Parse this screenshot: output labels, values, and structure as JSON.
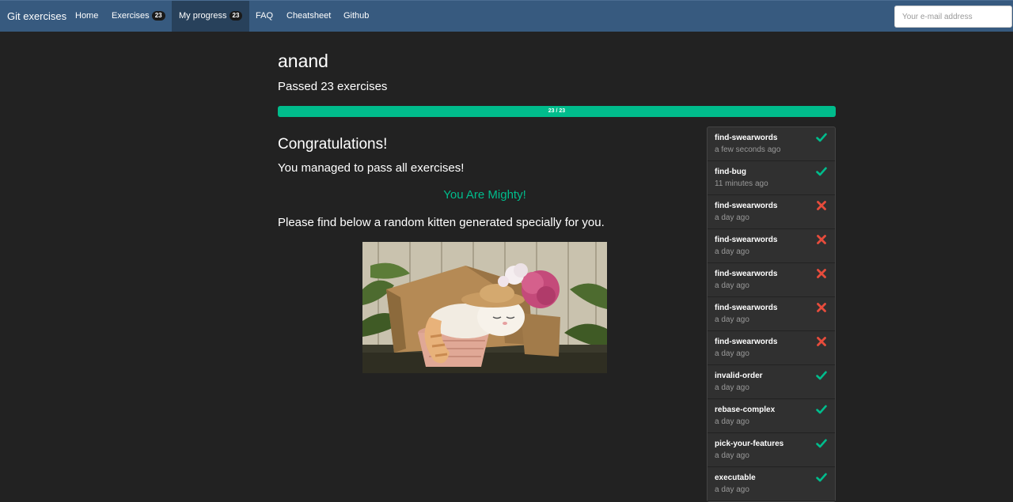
{
  "navbar": {
    "brand": "Git exercises",
    "items": [
      {
        "label": "Home",
        "badge": null
      },
      {
        "label": "Exercises",
        "badge": "23"
      },
      {
        "label": "My progress",
        "badge": "23"
      },
      {
        "label": "FAQ",
        "badge": null
      },
      {
        "label": "Cheatsheet",
        "badge": null
      },
      {
        "label": "Github",
        "badge": null
      }
    ],
    "active_item": "My progress",
    "email_placeholder": "Your e-mail address"
  },
  "profile": {
    "username": "anand",
    "passed_text": "Passed 23 exercises",
    "progress": {
      "passed": 23,
      "total": 23,
      "label": "23 / 23",
      "fraction": 1.0
    }
  },
  "main": {
    "congrats_title": "Congratulations!",
    "managed_text": "You managed to pass all exercises!",
    "mighty_text": "You Are Mighty!",
    "kitten_text": "Please find below a random kitten generated specially for you."
  },
  "colors": {
    "navbar": "#375a7f",
    "success": "#00bc8c",
    "fail": "#e74c3c",
    "background": "#222222"
  },
  "history": [
    {
      "name": "find-swearwords",
      "time": "a few seconds ago",
      "status": "passed",
      "icon": "check-icon"
    },
    {
      "name": "find-bug",
      "time": "11 minutes ago",
      "status": "passed",
      "icon": "check-icon"
    },
    {
      "name": "find-swearwords",
      "time": "a day ago",
      "status": "failed",
      "icon": "cross-icon"
    },
    {
      "name": "find-swearwords",
      "time": "a day ago",
      "status": "failed",
      "icon": "cross-icon"
    },
    {
      "name": "find-swearwords",
      "time": "a day ago",
      "status": "failed",
      "icon": "cross-icon"
    },
    {
      "name": "find-swearwords",
      "time": "a day ago",
      "status": "failed",
      "icon": "cross-icon"
    },
    {
      "name": "find-swearwords",
      "time": "a day ago",
      "status": "failed",
      "icon": "cross-icon"
    },
    {
      "name": "invalid-order",
      "time": "a day ago",
      "status": "passed",
      "icon": "check-icon"
    },
    {
      "name": "rebase-complex",
      "time": "a day ago",
      "status": "passed",
      "icon": "check-icon"
    },
    {
      "name": "pick-your-features",
      "time": "a day ago",
      "status": "passed",
      "icon": "check-icon"
    },
    {
      "name": "executable",
      "time": "a day ago",
      "status": "passed",
      "icon": "check-icon"
    }
  ]
}
